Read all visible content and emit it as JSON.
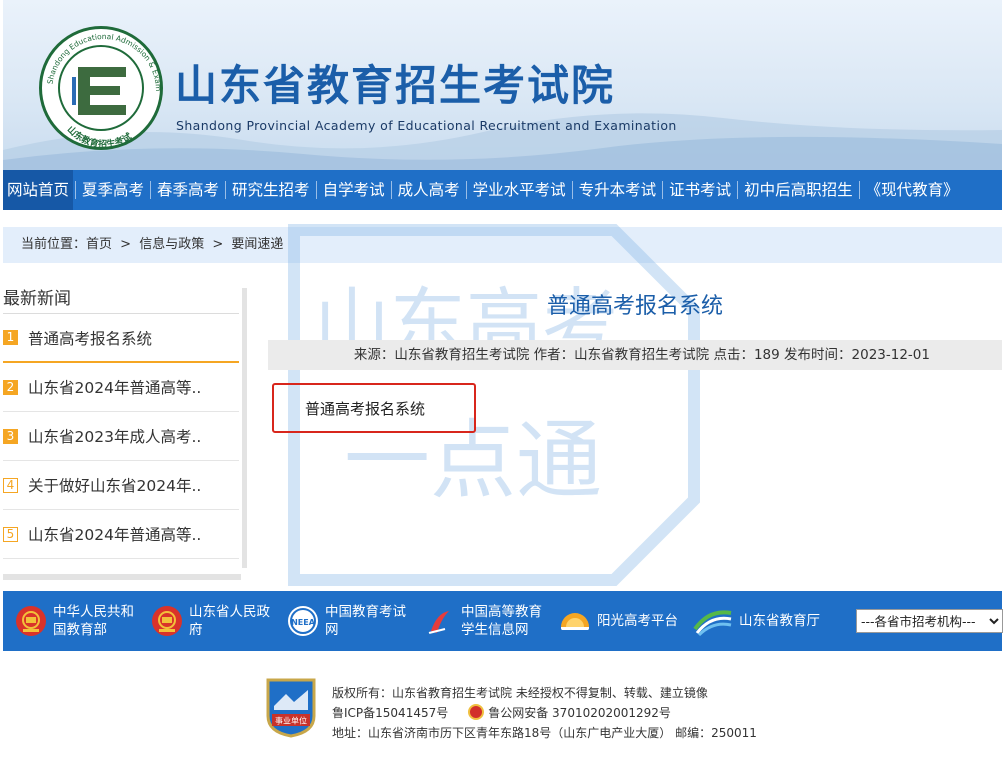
{
  "header": {
    "title": "山东省教育招生考试院",
    "subtitle": "Shandong Provincial Academy of Educational Recruitment and Examination",
    "logo_ring_text": "Shandong Educational Admission & Examinations",
    "logo_bottom_text": "山东教育招生考试",
    "logo_icon": "academy-logo-icon"
  },
  "nav": {
    "items": [
      {
        "label": "网站首页",
        "active": true
      },
      {
        "label": "夏季高考"
      },
      {
        "label": "春季高考"
      },
      {
        "label": "研究生招考"
      },
      {
        "label": "自学考试"
      },
      {
        "label": "成人高考"
      },
      {
        "label": "学业水平考试"
      },
      {
        "label": "专升本考试"
      },
      {
        "label": "证书考试"
      },
      {
        "label": "初中后高职招生"
      },
      {
        "label": "《现代教育》"
      }
    ]
  },
  "breadcrumb": {
    "prefix": "当前位置：",
    "home": "首页",
    "sep": ">",
    "level1": "信息与政策",
    "level2": "要闻速递"
  },
  "sidebar": {
    "title": "最新新闻",
    "items": [
      {
        "num": "1",
        "label": "普通高考报名系统"
      },
      {
        "num": "2",
        "label": "山东省2024年普通高等.."
      },
      {
        "num": "3",
        "label": "山东省2023年成人高考.."
      },
      {
        "num": "4",
        "label": "关于做好山东省2024年.."
      },
      {
        "num": "5",
        "label": "山东省2024年普通高等.."
      }
    ]
  },
  "article": {
    "title": "普通高考报名系统",
    "meta": "来源：山东省教育招生考试院 作者：山东省教育招生考试院 点击：189 发布时间：2023-12-01",
    "link_text": "普通高考报名系统"
  },
  "watermark": {
    "line1": "山东高考",
    "line2": "一点通"
  },
  "links": {
    "items": [
      {
        "line1": "中华人民共和",
        "line2": "国教育部",
        "icon": "national-emblem-icon"
      },
      {
        "line1": "山东省人民政",
        "line2": "府",
        "icon": "national-emblem-icon"
      },
      {
        "line1": "中国教育考试",
        "line2": "网",
        "icon": "neea-logo-icon"
      },
      {
        "line1": "中国高等教育",
        "line2": "学生信息网",
        "icon": "chsi-logo-icon"
      },
      {
        "line1": "阳光高考平台",
        "line2": "",
        "icon": "sunshine-logo-icon"
      },
      {
        "line1": "山东省教育厅",
        "line2": "",
        "icon": "sd-edu-logo-icon"
      }
    ],
    "select_value": "---各省市招考机构---"
  },
  "footer": {
    "badge_text": "事业单位",
    "line1": "版权所有：山东省教育招生考试院 未经授权不得复制、转载、建立镜像",
    "icp": "鲁ICP备15041457号",
    "police": "鲁公网安备 37010202001292号",
    "address": "地址：山东省济南市历下区青年东路18号（山东广电产业大厦） 邮编：250011"
  },
  "colors": {
    "primary_blue": "#1f6fc7",
    "title_blue": "#1b5ea9",
    "accent_orange": "#f5a623",
    "highlight_red": "#d8261c"
  }
}
